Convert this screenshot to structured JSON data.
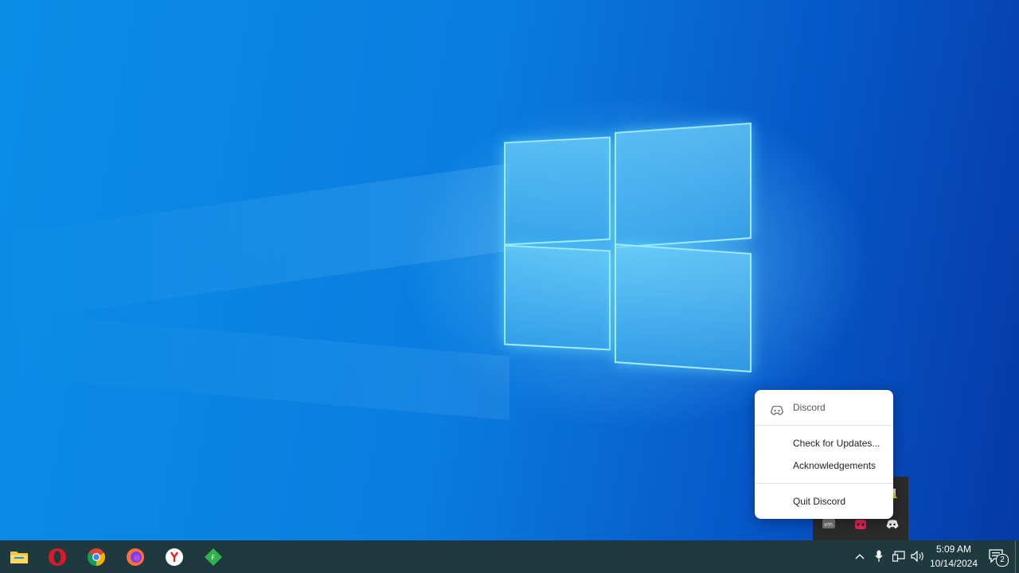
{
  "context_menu": {
    "header": "Discord",
    "items": [
      "Check for Updates...",
      "Acknowledgements"
    ],
    "quit": "Quit Discord"
  },
  "taskbar": {
    "apps": [
      "file-explorer",
      "opera",
      "chrome",
      "firefox",
      "yandex-browser",
      "green-diamond-app"
    ]
  },
  "tray": {
    "clock_time": "5:09 AM",
    "clock_date": "10/14/2024",
    "notification_count": "2",
    "overflow_icons": [
      "warning-badge-icon",
      "vm-icon",
      "red-app-icon",
      "discord-icon"
    ]
  }
}
